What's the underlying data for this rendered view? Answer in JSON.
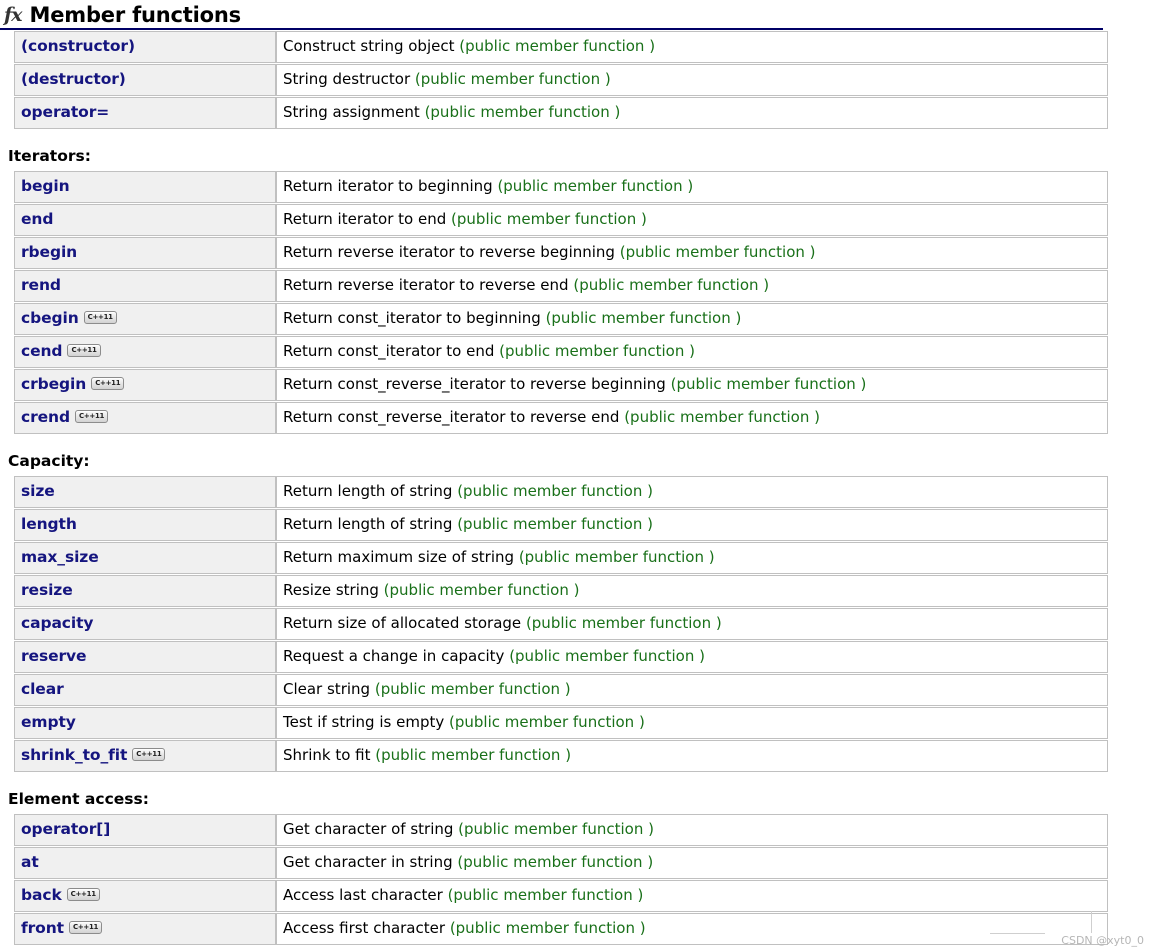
{
  "header": {
    "icon": "fx-function-icon",
    "icon_glyph": "fx",
    "title": "Member functions"
  },
  "colors": {
    "link": "#15157f",
    "note": "#197019",
    "rule": "#000066",
    "name_cell_bg": "#f0f0f0",
    "border": "#c0c0c0"
  },
  "badges": {
    "cpp11": "C++11"
  },
  "sections": [
    {
      "title": null,
      "rows": [
        {
          "name": "(constructor)",
          "cpp11": false,
          "desc_main": "Construct string object",
          "desc_note": "(public member function )"
        },
        {
          "name": "(destructor)",
          "cpp11": false,
          "desc_main": "String destructor",
          "desc_note": "(public member function )"
        },
        {
          "name": "operator=",
          "cpp11": false,
          "desc_main": "String assignment",
          "desc_note": "(public member function )"
        }
      ]
    },
    {
      "title": "Iterators:",
      "rows": [
        {
          "name": "begin",
          "cpp11": false,
          "desc_main": "Return iterator to beginning",
          "desc_note": "(public member function )"
        },
        {
          "name": "end",
          "cpp11": false,
          "desc_main": "Return iterator to end",
          "desc_note": "(public member function )"
        },
        {
          "name": "rbegin",
          "cpp11": false,
          "desc_main": "Return reverse iterator to reverse beginning",
          "desc_note": "(public member function )"
        },
        {
          "name": "rend",
          "cpp11": false,
          "desc_main": "Return reverse iterator to reverse end",
          "desc_note": "(public member function )"
        },
        {
          "name": "cbegin",
          "cpp11": true,
          "desc_main": "Return const_iterator to beginning",
          "desc_note": "(public member function )"
        },
        {
          "name": "cend",
          "cpp11": true,
          "desc_main": "Return const_iterator to end",
          "desc_note": "(public member function )"
        },
        {
          "name": "crbegin",
          "cpp11": true,
          "desc_main": "Return const_reverse_iterator to reverse beginning",
          "desc_note": "(public member function )"
        },
        {
          "name": "crend",
          "cpp11": true,
          "desc_main": "Return const_reverse_iterator to reverse end",
          "desc_note": "(public member function )"
        }
      ]
    },
    {
      "title": "Capacity:",
      "rows": [
        {
          "name": "size",
          "cpp11": false,
          "desc_main": "Return length of string",
          "desc_note": "(public member function )"
        },
        {
          "name": "length",
          "cpp11": false,
          "desc_main": "Return length of string",
          "desc_note": "(public member function )"
        },
        {
          "name": "max_size",
          "cpp11": false,
          "desc_main": "Return maximum size of string",
          "desc_note": "(public member function )"
        },
        {
          "name": "resize",
          "cpp11": false,
          "desc_main": "Resize string",
          "desc_note": "(public member function )"
        },
        {
          "name": "capacity",
          "cpp11": false,
          "desc_main": "Return size of allocated storage",
          "desc_note": "(public member function )"
        },
        {
          "name": "reserve",
          "cpp11": false,
          "desc_main": "Request a change in capacity",
          "desc_note": "(public member function )"
        },
        {
          "name": "clear",
          "cpp11": false,
          "desc_main": "Clear string",
          "desc_note": "(public member function )"
        },
        {
          "name": "empty",
          "cpp11": false,
          "desc_main": "Test if string is empty",
          "desc_note": "(public member function )"
        },
        {
          "name": "shrink_to_fit",
          "cpp11": true,
          "desc_main": "Shrink to fit",
          "desc_note": "(public member function )"
        }
      ]
    },
    {
      "title": "Element access:",
      "rows": [
        {
          "name": "operator[]",
          "cpp11": false,
          "desc_main": "Get character of string",
          "desc_note": "(public member function )"
        },
        {
          "name": "at",
          "cpp11": false,
          "desc_main": "Get character in string",
          "desc_note": "(public member function )"
        },
        {
          "name": "back",
          "cpp11": true,
          "desc_main": "Access last character",
          "desc_note": "(public member function )"
        },
        {
          "name": "front",
          "cpp11": true,
          "desc_main": "Access first character",
          "desc_note": "(public member function )"
        }
      ]
    }
  ],
  "watermark": "CSDN @xyt0_0"
}
